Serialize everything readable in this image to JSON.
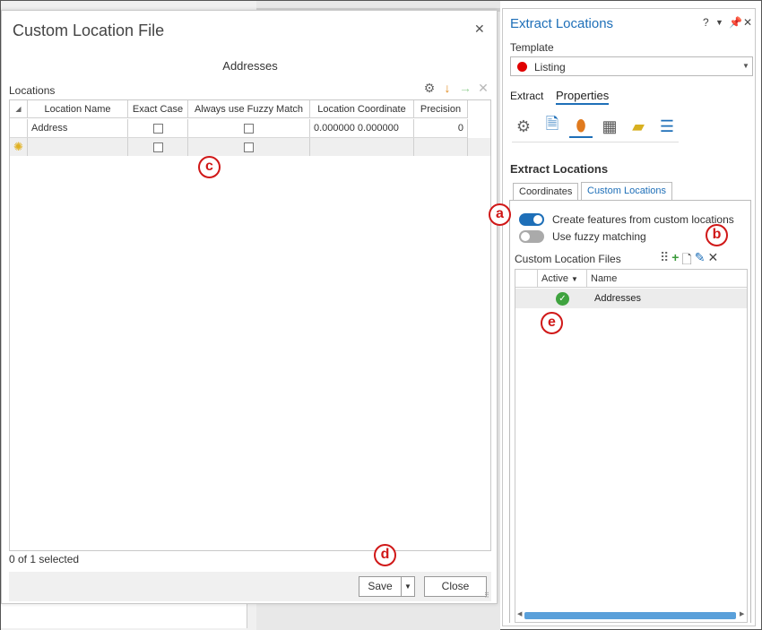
{
  "dialog": {
    "title": "Custom Location File",
    "subtitle": "Addresses",
    "section_label": "Locations",
    "columns": [
      "Location Name",
      "Exact Case",
      "Always use Fuzzy Match",
      "Location Coordinate",
      "Precision"
    ],
    "rows": [
      {
        "name": "Address",
        "exact_case": false,
        "fuzzy": false,
        "coordinate": "0.000000 0.000000",
        "precision": "0"
      }
    ],
    "status": "0 of 1 selected",
    "save_label": "Save",
    "close_label": "Close"
  },
  "pane": {
    "title": "Extract Locations",
    "help": "?",
    "template_label": "Template",
    "template_value": "Listing",
    "template_color": "#e00000",
    "tabs": [
      "Extract",
      "Properties"
    ],
    "active_tab": "Properties",
    "icons": [
      "gear-lightning-icon",
      "document-icon",
      "location-pin-icon",
      "table-icon",
      "export-icon",
      "sliders-icon"
    ],
    "section_title": "Extract Locations",
    "subtabs": [
      "Coordinates",
      "Custom Locations"
    ],
    "active_subtab": "Custom Locations",
    "toggle_create_label": "Create features from custom locations",
    "toggle_create_on": true,
    "toggle_fuzzy_label": "Use fuzzy matching",
    "toggle_fuzzy_on": false,
    "clf_label": "Custom Location Files",
    "clf_columns": [
      "Active",
      "Name"
    ],
    "clf_rows": [
      {
        "active": true,
        "name": "Addresses"
      }
    ]
  },
  "markers": [
    "a",
    "b",
    "c",
    "d",
    "e"
  ],
  "colors": {
    "accent": "#1e6fb8",
    "marker": "#d01818",
    "active_green": "#3fa33f"
  }
}
